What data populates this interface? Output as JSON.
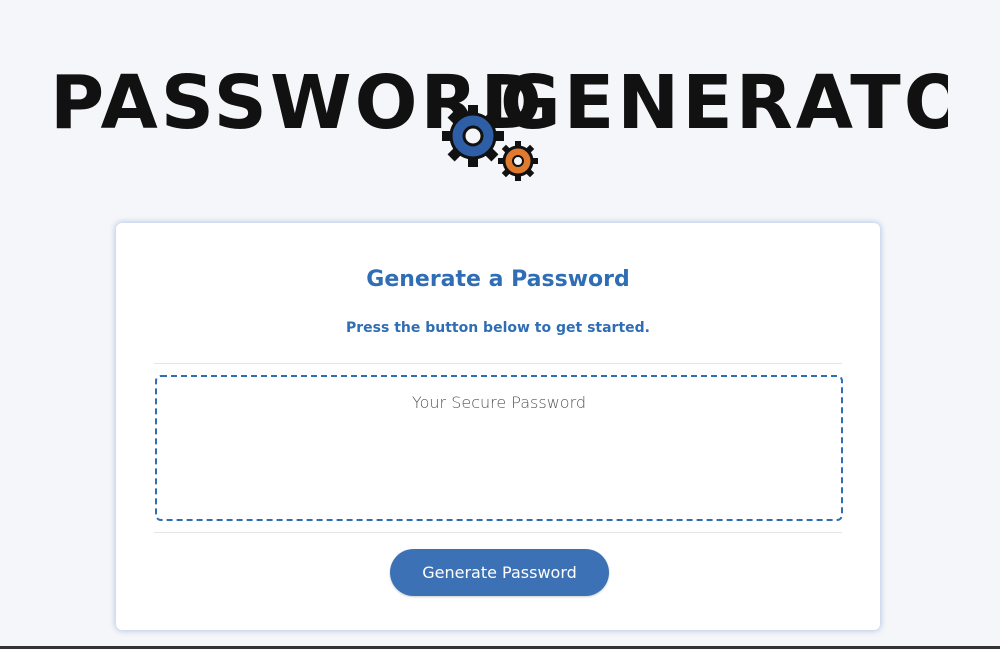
{
  "logo": {
    "text_left": "PASSWORD",
    "text_right": "GENERATOR",
    "gear_large_color": "#2e5fa6",
    "gear_small_color": "#e07a2e"
  },
  "card": {
    "title": "Generate a Password",
    "subtitle": "Press the button below to get started.",
    "password_placeholder": "Your Secure Password",
    "password_value": "",
    "button_label": "Generate Password"
  },
  "colors": {
    "accent": "#2f6db4",
    "button": "#3d71b5",
    "background": "#f5f6f9"
  }
}
